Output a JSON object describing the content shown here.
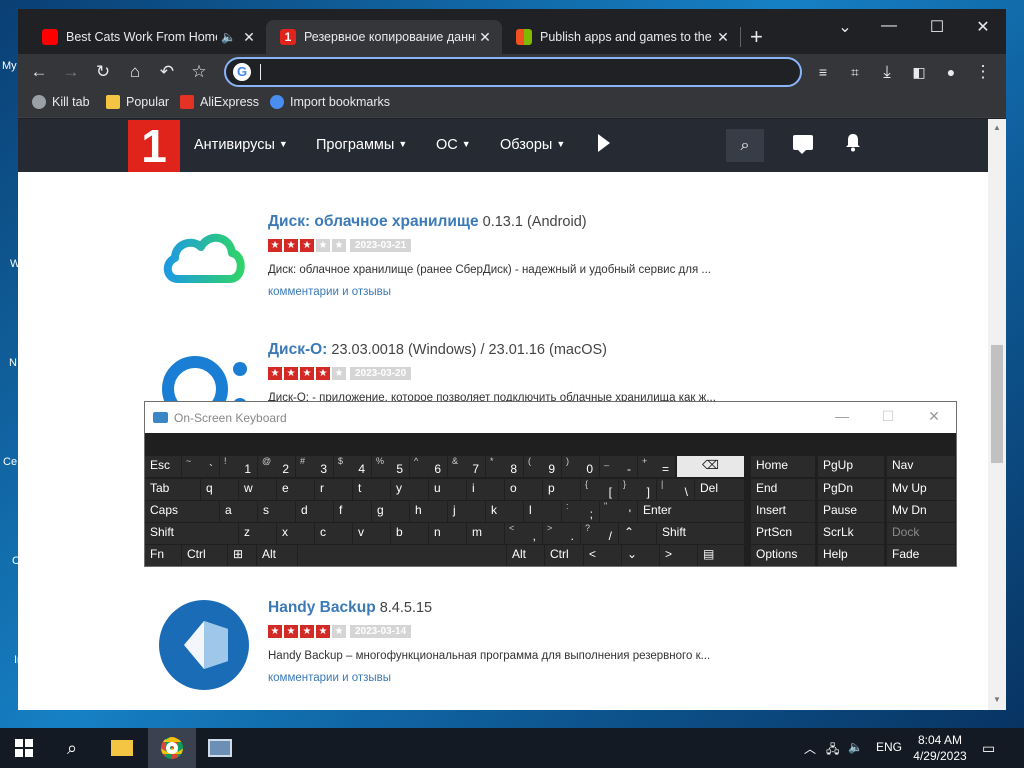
{
  "desktop": {
    "fragments": [
      "My",
      "W",
      "N",
      "Ce",
      "C",
      "Ir"
    ]
  },
  "browser": {
    "tabs": [
      {
        "title": "Best Cats Work From Home",
        "favicon": "youtube-icon",
        "audio": true
      },
      {
        "title": "Резервное копирование данны",
        "favicon": "1-site-icon",
        "active": true
      },
      {
        "title": "Publish apps and games to the M",
        "favicon": "microsoft-icon"
      }
    ],
    "new_tab": "+",
    "window_controls": {
      "minimize": "—",
      "maximize": "☐",
      "close": "✕",
      "list": "⌄"
    },
    "omnibox": {
      "value": "",
      "placeholder": ""
    },
    "bookmarks": [
      {
        "label": "Kill tab",
        "icon": "globe-icon"
      },
      {
        "label": "Popular",
        "icon": "folder-icon"
      },
      {
        "label": "AliExpress",
        "icon": "aliexpress-icon"
      },
      {
        "label": "Import bookmarks",
        "icon": "gear-icon"
      }
    ]
  },
  "site": {
    "logo": "1",
    "nav": [
      "Антивирусы",
      "Программы",
      "ОС",
      "Обзоры"
    ],
    "apps": [
      {
        "name": "Диск: облачное хранилище",
        "version": "0.13.1 (Android)",
        "stars": 3,
        "date": "2023-03-21",
        "description": "Диск: облачное хранилище (ранее СберДиск) - надежный и удобный сервис для ...",
        "link": "комментарии и отзывы"
      },
      {
        "name": "Диск-О:",
        "version": "23.03.0018 (Windows) / 23.01.16 (macOS)",
        "stars": 4,
        "date": "2023-03-20",
        "description": "Диск-О: - приложение, которое позволяет подключить облачные хранилища как ж...",
        "link": "комментарии и отзывы"
      },
      {
        "name": "Handy Backup",
        "version": "8.4.5.15",
        "stars": 4,
        "date": "2023-03-14",
        "description": "Handy Backup – многофункциональная программа для выполнения резервного к...",
        "link": "комментарии и отзывы"
      }
    ]
  },
  "osk": {
    "title": "On-Screen Keyboard",
    "row1": [
      {
        "main": "Esc"
      },
      {
        "sub": "~",
        "main": "`"
      },
      {
        "sub": "!",
        "main": "1"
      },
      {
        "sub": "@",
        "main": "2"
      },
      {
        "sub": "#",
        "main": "3"
      },
      {
        "sub": "$",
        "main": "4"
      },
      {
        "sub": "%",
        "main": "5"
      },
      {
        "sub": "^",
        "main": "6"
      },
      {
        "sub": "&",
        "main": "7"
      },
      {
        "sub": "*",
        "main": "8"
      },
      {
        "sub": "(",
        "main": "9"
      },
      {
        "sub": ")",
        "main": "0"
      },
      {
        "sub": "_",
        "main": "-"
      },
      {
        "sub": "+",
        "main": "="
      }
    ],
    "row2": [
      "Tab",
      "q",
      "w",
      "e",
      "r",
      "t",
      "y",
      "u",
      "i",
      "o",
      "p"
    ],
    "row2_extra": [
      {
        "sub": "{",
        "main": "["
      },
      {
        "sub": "}",
        "main": "]"
      },
      {
        "sub": "|",
        "main": "\\"
      },
      {
        "main": "Del"
      }
    ],
    "row3": [
      "Caps",
      "a",
      "s",
      "d",
      "f",
      "g",
      "h",
      "j",
      "k",
      "l"
    ],
    "row3_extra": [
      {
        "sub": ":",
        "main": ";"
      },
      {
        "sub": "\"",
        "main": "'"
      },
      {
        "main": "Enter"
      }
    ],
    "row4": [
      "Shift",
      "z",
      "x",
      "c",
      "v",
      "b",
      "n",
      "m"
    ],
    "row4_extra": [
      {
        "sub": "<",
        "main": ","
      },
      {
        "sub": ">",
        "main": "."
      },
      {
        "sub": "?",
        "main": "/"
      },
      {
        "main": "⌃"
      },
      {
        "main": "Shift"
      }
    ],
    "row5": [
      "Fn",
      "Ctrl",
      "⊞",
      "Alt",
      "",
      "Alt",
      "Ctrl",
      "<",
      "⌄",
      ">",
      "▤"
    ],
    "nav_keys": [
      [
        "Home",
        "PgUp",
        "Nav"
      ],
      [
        "End",
        "PgDn",
        "Mv Up"
      ],
      [
        "Insert",
        "Pause",
        "Mv Dn"
      ],
      [
        "PrtScn",
        "ScrLk",
        "Dock"
      ],
      [
        "Options",
        "Help",
        "Fade"
      ]
    ],
    "backspace": "⌫"
  },
  "taskbar": {
    "language": "ENG",
    "time": "8:04 AM",
    "date": "4/29/2023"
  }
}
